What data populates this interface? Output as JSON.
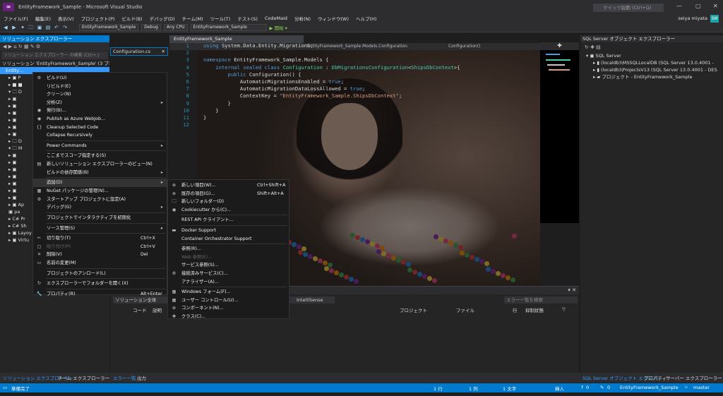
{
  "window": {
    "title": "EntityFramework_Sample - Microsoft Visual Studio",
    "quick_launch": "クイック起動 (Ctrl+Q)",
    "user": "seiya miyata",
    "avatar": "SM"
  },
  "menu": [
    "ファイル(F)",
    "編集(E)",
    "表示(V)",
    "プロジェクト(P)",
    "ビルド(B)",
    "デバッグ(D)",
    "チーム(M)",
    "ツール(T)",
    "テスト(S)",
    "CodeMaid",
    "分析(N)",
    "ウィンドウ(W)",
    "ヘルプ(H)"
  ],
  "toolbar": {
    "project": "EntityFramework_Sample",
    "config": "Debug",
    "platform": "Any CPU",
    "startup": "EntityFramework_Sample",
    "start": "▶ 開始 ▾"
  },
  "solution_explorer": {
    "title": "ソリューション エクスプローラー",
    "search_placeholder": "ソリューション エクスプローラー の検索 (Ctrl+;)",
    "rows": [
      "ソリューション 'EntityFramework_Sample' (3 プロジェ",
      "Entity…",
      "▸ ▣ P",
      "▸ ■ ■",
      "▾ 🗀 D",
      "  ▸ ▣",
      "  ▸ ▣",
      "  ▸ ▣",
      "  ▸ ▣",
      "  ▸ ▣",
      "  ▸ ▣",
      "▸ 🗀 D",
      "▾ 🗀 M",
      "  ▸ ▣",
      "  ▸ ▣",
      "  ▸ ▣",
      "  ▸ ▣",
      "  ▸ ▣",
      "  ▸ ▣",
      "  ▸ ▣",
      "▸ ▣ Ap",
      "  ▣ pa",
      "▸ C# Pr",
      "▸ C# Sh",
      "▸ ▣ Layoy",
      "▸ ▣ Virtu"
    ]
  },
  "config_tab": "Configuration.cs",
  "editor": {
    "doc_tab": "EntityFramework_Sample",
    "nav": [
      "EntityFramework_Sample.Models.Configuration",
      "Configuration()"
    ],
    "lines": [
      {
        "n": "1",
        "t": [
          [
            "kw",
            "using"
          ],
          [
            "tx",
            " System.Data.Entity.Migrations;"
          ]
        ]
      },
      {
        "n": "2",
        "t": []
      },
      {
        "n": "3",
        "t": [
          [
            "kw",
            "namespace"
          ],
          [
            "tx",
            " EntityFramework_Sample.Models {"
          ]
        ]
      },
      {
        "n": "4",
        "t": [
          [
            "tx",
            "    "
          ],
          [
            "kw",
            "internal sealed class"
          ],
          [
            "tx",
            " "
          ],
          [
            "ty",
            "Configuration"
          ],
          [
            "tx",
            " : "
          ],
          [
            "ty",
            "DbMigrationsConfiguration"
          ],
          [
            "tx",
            "<"
          ],
          [
            "ty",
            "ShipsDbContext"
          ],
          [
            "tx",
            ">{"
          ]
        ]
      },
      {
        "n": "5",
        "t": [
          [
            "tx",
            "        "
          ],
          [
            "kw",
            "public"
          ],
          [
            "tx",
            " Configuration() {"
          ]
        ]
      },
      {
        "n": "6",
        "t": [
          [
            "tx",
            "            AutomaticMigrationsEnabled = "
          ],
          [
            "kw",
            "true"
          ],
          [
            "tx",
            ";"
          ]
        ]
      },
      {
        "n": "7",
        "t": [
          [
            "tx",
            "            AutomaticMigrationDataLossAllowed = "
          ],
          [
            "kw",
            "true"
          ],
          [
            "tx",
            ";"
          ]
        ]
      },
      {
        "n": "8",
        "t": [
          [
            "tx",
            "            ContextKey = "
          ],
          [
            "st",
            "\"EntityFramework_Sample.ShipsDbContext\""
          ],
          [
            "tx",
            ";"
          ]
        ]
      },
      {
        "n": "9",
        "t": [
          [
            "tx",
            "        }"
          ]
        ]
      },
      {
        "n": "10",
        "t": [
          [
            "tx",
            "    }"
          ]
        ]
      },
      {
        "n": "11",
        "t": [
          [
            "tx",
            "}"
          ]
        ]
      },
      {
        "n": "12",
        "t": []
      }
    ]
  },
  "context_menu": [
    {
      "icon": "⚙",
      "label": "ビルド(U)"
    },
    {
      "icon": "",
      "label": "リビルド(E)"
    },
    {
      "icon": "",
      "label": "クリーン(N)"
    },
    {
      "icon": "",
      "label": "分析(Z)",
      "sub": true
    },
    {
      "icon": "◉",
      "label": "発行(B)..."
    },
    {
      "icon": "◉",
      "label": "Publish as Azure WebJob..."
    },
    {
      "icon": "{}",
      "label": "Cleanup Selected Code"
    },
    {
      "icon": "",
      "label": "Collapse Recursively"
    },
    {
      "sep": true
    },
    {
      "icon": "",
      "label": "Power Commands",
      "sub": true
    },
    {
      "sep": true
    },
    {
      "icon": "",
      "label": "ここまでスコープ指定する(S)"
    },
    {
      "icon": "▤",
      "label": "新しいソリューション エクスプローラーのビュー(N)"
    },
    {
      "icon": "",
      "label": "ビルドの依存関係(B)",
      "sub": true
    },
    {
      "sep": true
    },
    {
      "icon": "",
      "label": "追加(D)",
      "sub": true,
      "hl": true
    },
    {
      "icon": "▦",
      "label": "NuGet パッケージの管理(N)..."
    },
    {
      "icon": "⚙",
      "label": "スタートアップ プロジェクトに設定(A)"
    },
    {
      "icon": "",
      "label": "デバッグ(G)",
      "sub": true
    },
    {
      "sep": true
    },
    {
      "icon": "",
      "label": "プロジェクトでインタラクティブを初期化"
    },
    {
      "sep": true
    },
    {
      "icon": "",
      "label": "ソース管理(S)",
      "sub": true
    },
    {
      "sep": true
    },
    {
      "icon": "✂",
      "label": "切り取り(T)",
      "shortcut": "Ctrl+X"
    },
    {
      "icon": "▢",
      "label": "貼り付け(P)",
      "shortcut": "Ctrl+V",
      "disabled": true
    },
    {
      "icon": "✕",
      "label": "削除(V)",
      "shortcut": "Del"
    },
    {
      "icon": "▭",
      "label": "名前の変更(M)"
    },
    {
      "sep": true
    },
    {
      "icon": "",
      "label": "プロジェクトのアンロード(L)"
    },
    {
      "sep": true
    },
    {
      "icon": "↻",
      "label": "エクスプローラーでフォルダーを開く(X)"
    },
    {
      "sep": true
    },
    {
      "icon": "🔧",
      "label": "プロパティ(R)",
      "shortcut": "Alt+Enter"
    }
  ],
  "submenu": [
    {
      "icon": "⊕",
      "label": "新しい項目(W)...",
      "shortcut": "Ctrl+Shift+A"
    },
    {
      "icon": "⊕",
      "label": "既存の項目(G)...",
      "shortcut": "Shift+Alt+A"
    },
    {
      "icon": "🗀",
      "label": "新しいフォルダー(D)"
    },
    {
      "icon": "◉",
      "label": "Cookiecutter から(C)..."
    },
    {
      "sep": true
    },
    {
      "icon": "",
      "label": "REST API クライアント..."
    },
    {
      "sep": true
    },
    {
      "icon": "▬",
      "label": "Docker Support"
    },
    {
      "icon": "",
      "label": "Container Orchestrator Support"
    },
    {
      "sep": true
    },
    {
      "icon": "",
      "label": "参照(R)..."
    },
    {
      "icon": "",
      "label": "Web 参照(E)...",
      "disabled": true
    },
    {
      "icon": "",
      "label": "サービス参照(S)..."
    },
    {
      "icon": "⚙",
      "label": "接続済みサービス(C)..."
    },
    {
      "icon": "",
      "label": "アナライザー(A)..."
    },
    {
      "sep": true
    },
    {
      "icon": "▦",
      "label": "Windows フォーム(F)..."
    },
    {
      "icon": "▦",
      "label": "ユーザー コントロール(U)..."
    },
    {
      "icon": "⊕",
      "label": "コンポーネント(N)..."
    },
    {
      "icon": "✚",
      "label": "クラス(C)..."
    }
  ],
  "error_list": {
    "scope": "ソリューション全体",
    "filter": "IntelliSense",
    "search": "エラー一覧を検索",
    "cols": [
      "コード",
      "説明",
      "プロジェクト",
      "ファイル",
      "行",
      "抑制状態"
    ]
  },
  "sql_explorer": {
    "title": "SQL Server オブジェクト エクスプローラー",
    "rows": [
      "SQL Server",
      "(localdb)\\MSSQLLocalDB (SQL Server 13.0.4001 -",
      "(localdb)\\ProjectsV13 (SQL Server 13.0.4001 - DES",
      "プロジェクト - EntityFramework_Sample"
    ]
  },
  "bottom_tabs": {
    "left": [
      "ソリューション エクスプローラー",
      "チーム エクスプローラー"
    ],
    "mid": [
      "エラー一覧",
      "出力"
    ],
    "right": [
      "SQL Server オブジェクト エクスプ...",
      "プロパティ",
      "サーバー エクスプローラー"
    ]
  },
  "status": {
    "ready": "準備完了",
    "line": "1 行",
    "col": "1 列",
    "ch": "1 文字",
    "ins": "挿入",
    "up": "0",
    "pencil": "0",
    "project": "EntityFramework_Sample",
    "branch": "master"
  }
}
